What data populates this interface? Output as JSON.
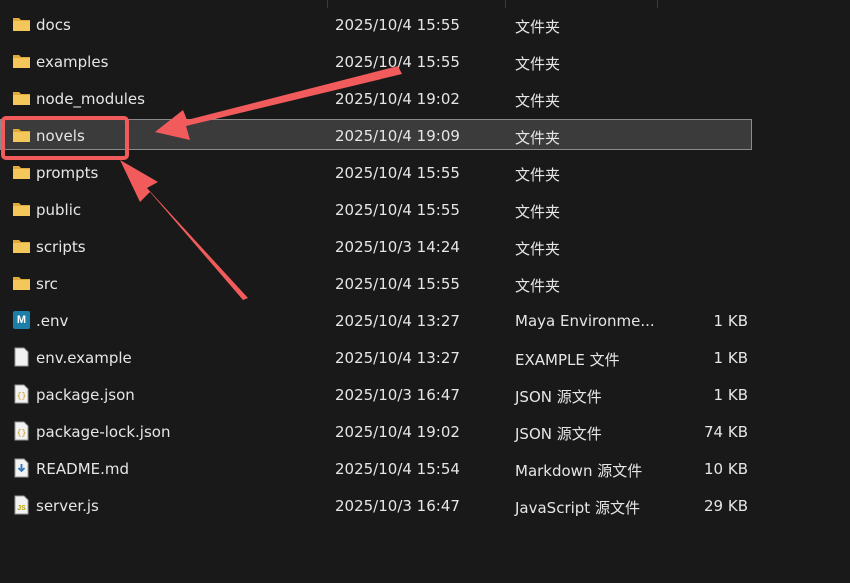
{
  "files": [
    {
      "name": "docs",
      "date": "2025/10/4 15:55",
      "type": "文件夹",
      "size": "",
      "icon": "folder-icon"
    },
    {
      "name": "examples",
      "date": "2025/10/4 15:55",
      "type": "文件夹",
      "size": "",
      "icon": "folder-icon"
    },
    {
      "name": "node_modules",
      "date": "2025/10/4 19:02",
      "type": "文件夹",
      "size": "",
      "icon": "folder-icon"
    },
    {
      "name": "novels",
      "date": "2025/10/4 19:09",
      "type": "文件夹",
      "size": "",
      "icon": "folder-icon",
      "selected": true
    },
    {
      "name": "prompts",
      "date": "2025/10/4 15:55",
      "type": "文件夹",
      "size": "",
      "icon": "folder-icon"
    },
    {
      "name": "public",
      "date": "2025/10/4 15:55",
      "type": "文件夹",
      "size": "",
      "icon": "folder-icon"
    },
    {
      "name": "scripts",
      "date": "2025/10/3 14:24",
      "type": "文件夹",
      "size": "",
      "icon": "folder-icon"
    },
    {
      "name": "src",
      "date": "2025/10/4 15:55",
      "type": "文件夹",
      "size": "",
      "icon": "folder-icon"
    },
    {
      "name": ".env",
      "date": "2025/10/4 13:27",
      "type": "Maya Environme...",
      "size": "1 KB",
      "icon": "maya-env-icon"
    },
    {
      "name": "env.example",
      "date": "2025/10/4 13:27",
      "type": "EXAMPLE 文件",
      "size": "1 KB",
      "icon": "file-icon"
    },
    {
      "name": "package.json",
      "date": "2025/10/3 16:47",
      "type": "JSON 源文件",
      "size": "1 KB",
      "icon": "json-file-icon"
    },
    {
      "name": "package-lock.json",
      "date": "2025/10/4 19:02",
      "type": "JSON 源文件",
      "size": "74 KB",
      "icon": "json-file-icon"
    },
    {
      "name": "README.md",
      "date": "2025/10/4 15:54",
      "type": "Markdown 源文件",
      "size": "10 KB",
      "icon": "markdown-file-icon"
    },
    {
      "name": "server.js",
      "date": "2025/10/3 16:47",
      "type": "JavaScript 源文件",
      "size": "29 KB",
      "icon": "js-file-icon"
    }
  ],
  "colors": {
    "background": "#191919",
    "selection": "#3b3b3b",
    "annotation": "#f25b5b",
    "folder": "#f4c75a"
  }
}
